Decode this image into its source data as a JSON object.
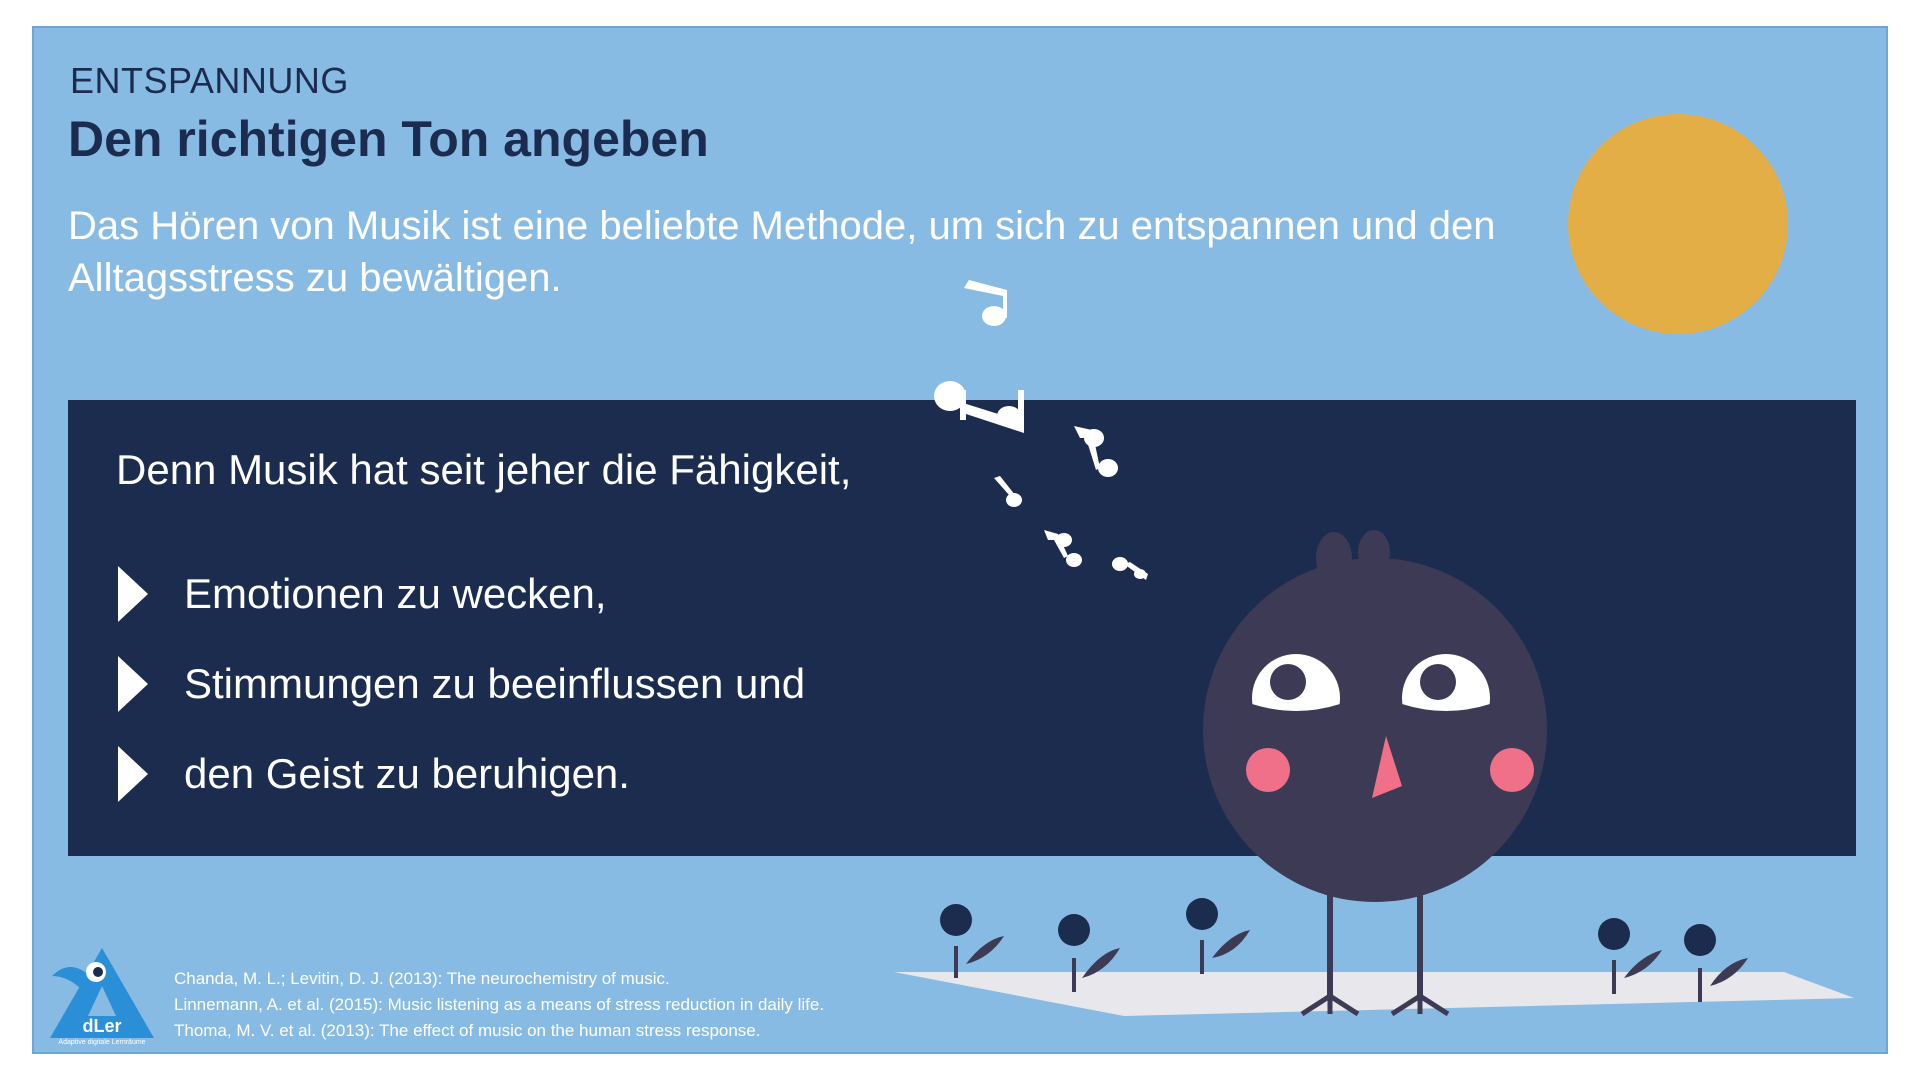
{
  "header": {
    "kicker": "ENTSPANNUNG",
    "title": "Den richtigen Ton angeben",
    "intro": "Das Hören von Musik ist eine beliebte Methode, um sich zu entspannen und den Alltagsstress zu bewältigen."
  },
  "panel": {
    "lead": "Denn Musik hat seit jeher die Fähigkeit,",
    "bullets": [
      "Emotionen zu wecken,",
      "Stimmungen zu beeinflussen und",
      "den Geist zu beruhigen."
    ]
  },
  "references": [
    "Chanda, M. L.; Levitin, D. J. (2013): The neurochemistry of music.",
    "Linnemann, A. et al. (2015): Music listening as a means of stress reduction in daily life.",
    "Thoma, M. V. et al. (2013): The effect of music on the human stress response."
  ],
  "logo": {
    "letter": "A",
    "text": "dLer",
    "subtitle": "Adaptive digitale Lernräume"
  },
  "colors": {
    "background": "#88bbe3",
    "panel": "#1b2c4e",
    "sun": "#e4ae47",
    "bird": "#3d3a55",
    "cheeks": "#f0708a",
    "beak": "#f0708a",
    "headphones": "#1b2c4e",
    "logo": "#2a8fd6"
  },
  "icons": [
    "music-note-icon",
    "play-arrow-icon",
    "sun-icon",
    "bird-with-headphones-icon",
    "flower-icon",
    "adler-logo-icon"
  ]
}
